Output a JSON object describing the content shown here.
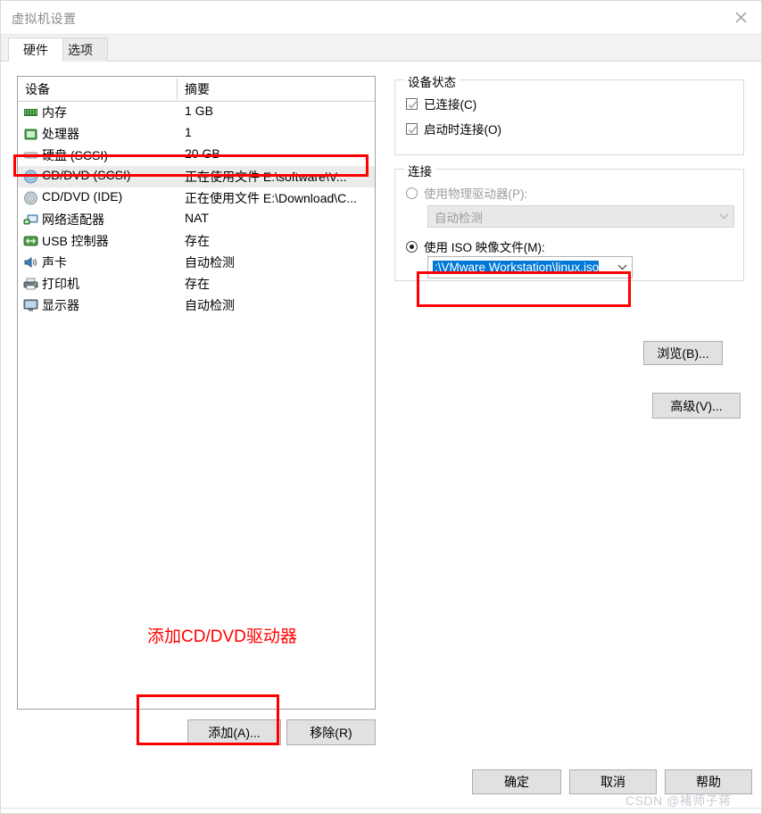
{
  "window": {
    "title": "虚拟机设置",
    "close_icon": "close-icon"
  },
  "tabs": [
    {
      "label": "硬件",
      "active": true
    },
    {
      "label": "选项",
      "active": false
    }
  ],
  "device_list": {
    "columns": [
      "设备",
      "摘要"
    ],
    "rows": [
      {
        "icon": "memory-icon",
        "name": "内存",
        "summary": "1 GB",
        "selected": false
      },
      {
        "icon": "processor-icon",
        "name": "处理器",
        "summary": "1",
        "selected": false
      },
      {
        "icon": "harddisk-icon",
        "name": "硬盘 (SCSI)",
        "summary": "20 GB",
        "selected": false
      },
      {
        "icon": "cddvd-icon",
        "name": "CD/DVD (SCSI)",
        "summary": "正在使用文件 E:\\software\\V...",
        "selected": true
      },
      {
        "icon": "cddvd-icon",
        "name": "CD/DVD (IDE)",
        "summary": "正在使用文件 E:\\Download\\C...",
        "selected": false
      },
      {
        "icon": "network-adapter-icon",
        "name": "网络适配器",
        "summary": "NAT",
        "selected": false
      },
      {
        "icon": "usb-icon",
        "name": "USB 控制器",
        "summary": "存在",
        "selected": false
      },
      {
        "icon": "sound-card-icon",
        "name": "声卡",
        "summary": "自动检测",
        "selected": false
      },
      {
        "icon": "printer-icon",
        "name": "打印机",
        "summary": "存在",
        "selected": false
      },
      {
        "icon": "display-icon",
        "name": "显示器",
        "summary": "自动检测",
        "selected": false
      }
    ],
    "add_label": "添加(A)...",
    "remove_label": "移除(R)"
  },
  "annotation": {
    "text": "添加CD/DVD驱动器",
    "color": "#ff0000"
  },
  "device_status": {
    "legend": "设备状态",
    "checkboxes": [
      {
        "label": "已连接(C)",
        "checked": true
      },
      {
        "label": "启动时连接(O)",
        "checked": true
      }
    ]
  },
  "connection": {
    "legend": "连接",
    "physical": {
      "label": "使用物理驱动器(P):",
      "selected": false,
      "disabled": true,
      "value": "自动检测"
    },
    "iso": {
      "label": "使用 ISO 映像文件(M):",
      "selected": true,
      "disabled": false,
      "value": ":\\VMware Workstation\\linux.iso",
      "value_highlighted": true
    },
    "browse_label": "浏览(B)..."
  },
  "advanced_label": "高级(V)...",
  "dialog_buttons": {
    "ok": "确定",
    "cancel": "取消",
    "help": "帮助"
  },
  "watermark": "CSDN @褚师子蒋"
}
